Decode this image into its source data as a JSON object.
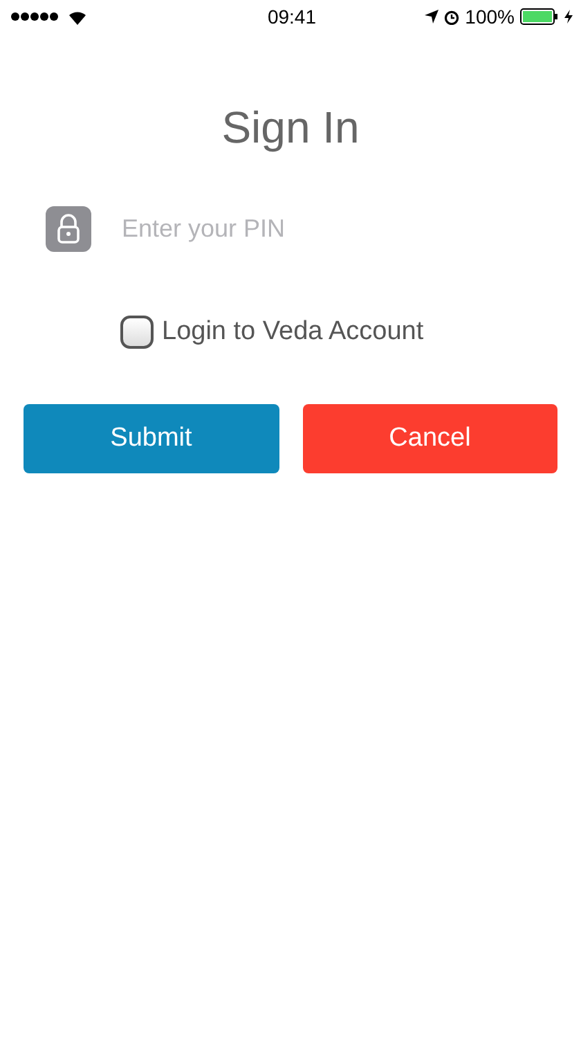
{
  "status_bar": {
    "time": "09:41",
    "battery": "100%"
  },
  "title": "Sign In",
  "pin_field": {
    "placeholder": "Enter your PIN"
  },
  "checkbox": {
    "label": "Login to Veda Account",
    "checked": false
  },
  "buttons": [
    {
      "label": "Submit",
      "kind": "primary"
    },
    {
      "label": "Cancel",
      "kind": "danger"
    }
  ]
}
